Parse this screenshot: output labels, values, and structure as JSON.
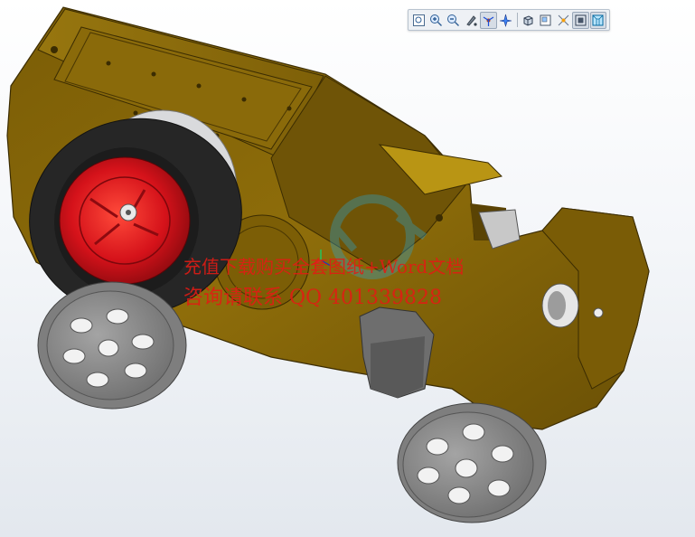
{
  "window": {
    "background_top": "#ffffff",
    "background_bottom": "#e3e8ee"
  },
  "toolbar": {
    "buttons": [
      {
        "icon": "zoom-fit-icon",
        "active": false
      },
      {
        "icon": "zoom-in-icon",
        "active": false
      },
      {
        "icon": "zoom-out-icon",
        "active": false
      },
      {
        "icon": "repaint-icon",
        "active": false
      },
      {
        "icon": "spin-center-icon",
        "active": true
      },
      {
        "icon": "view-orient-icon",
        "active": false
      },
      {
        "icon": "shading-icon",
        "active": false
      },
      {
        "icon": "saved-views-icon",
        "active": false
      },
      {
        "icon": "datum-display-icon",
        "active": false
      },
      {
        "icon": "model-display-icon",
        "active": true
      },
      {
        "icon": "perspective-icon",
        "active": true
      }
    ]
  },
  "model": {
    "name": "rebar-bender-3d-model",
    "body_color": "#8a6a09",
    "body_shadow_color": "#5e4604",
    "tire_color": "#2a2a2a",
    "hub_color": "#d4131a",
    "caster_wheel_color": "#8c8c8c",
    "roller_color": "#e6e6e6"
  },
  "watermark": {
    "line1": "充值下载购买全套图纸+Word文档",
    "line2": "咨询请联系 QQ 401339828",
    "color": "#e31b14"
  }
}
